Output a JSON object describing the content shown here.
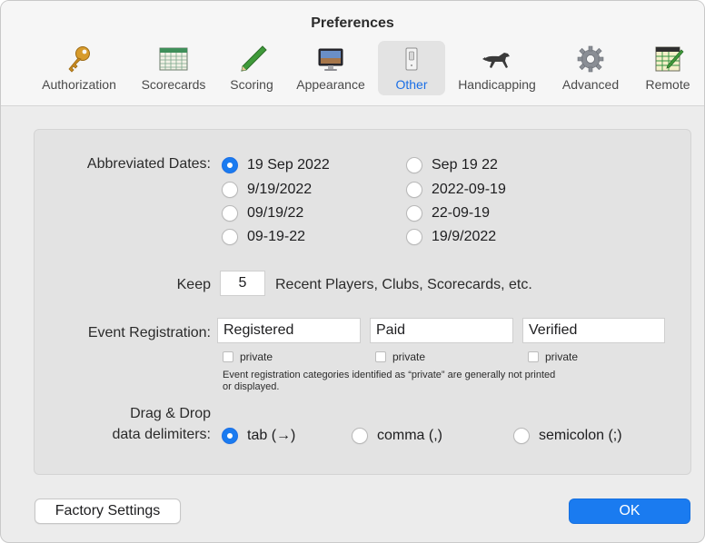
{
  "window": {
    "title": "Preferences"
  },
  "toolbar": {
    "items": [
      {
        "label": "Authorization",
        "icon": "key-icon"
      },
      {
        "label": "Scorecards",
        "icon": "scorecard-icon"
      },
      {
        "label": "Scoring",
        "icon": "pencil-icon"
      },
      {
        "label": "Appearance",
        "icon": "display-icon"
      },
      {
        "label": "Other",
        "icon": "switch-icon",
        "selected": true
      },
      {
        "label": "Handicapping",
        "icon": "horse-icon"
      },
      {
        "label": "Advanced",
        "icon": "gear-icon"
      },
      {
        "label": "Remote",
        "icon": "remote-scorecard-icon"
      }
    ]
  },
  "abbreviated_dates": {
    "label": "Abbreviated Dates:",
    "options": [
      "19 Sep 2022",
      "Sep 19 22",
      "9/19/2022",
      "2022-09-19",
      "09/19/22",
      "22-09-19",
      "09-19-22",
      "19/9/2022"
    ],
    "selected": "19 Sep 2022"
  },
  "keep": {
    "label": "Keep",
    "value": "5",
    "suffix": "Recent Players, Clubs, Scorecards, etc."
  },
  "event_registration": {
    "label": "Event Registration:",
    "fields": [
      {
        "value": "Registered",
        "private_label": "private",
        "private": false
      },
      {
        "value": "Paid",
        "private_label": "private",
        "private": false
      },
      {
        "value": "Verified",
        "private_label": "private",
        "private": false
      }
    ],
    "note_line1": "Event registration categories identified as “private” are generally not printed",
    "note_line2": "or displayed."
  },
  "delimiters": {
    "label_line1": "Drag & Drop",
    "label_line2": "data delimiters:",
    "options": [
      "tab (→)",
      "comma (,)",
      "semicolon (;)"
    ],
    "selected": "tab (→)"
  },
  "buttons": {
    "factory": "Factory Settings",
    "ok": "OK"
  },
  "colors": {
    "accent": "#1a7bf0",
    "selected_tab_text": "#1a6fe6"
  }
}
